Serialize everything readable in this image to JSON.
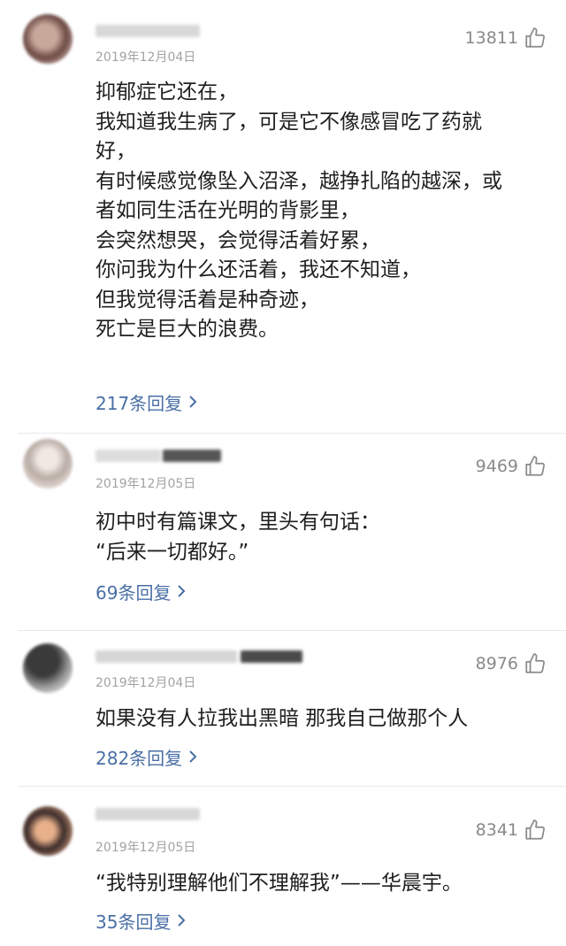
{
  "comments": [
    {
      "date": "2019年12月04日",
      "likes": "13811",
      "lines": [
        "抑郁症它还在，",
        "我知道我生病了，可是它不像感冒吃了药就",
        "好，",
        "有时候感觉像坠入沼泽，越挣扎陷的越深，或",
        "者如同生活在光明的背影里，",
        "会突然想哭，会觉得活着好累，",
        "你问我为什么还活着，我还不知道，",
        "但我觉得活着是种奇迹，",
        "死亡是巨大的浪费。"
      ],
      "replies": "217条回复"
    },
    {
      "date": "2019年12月05日",
      "likes": "9469",
      "lines": [
        "初中时有篇课文，里头有句话：",
        "“后来一切都好。”"
      ],
      "replies": "69条回复"
    },
    {
      "date": "2019年12月04日",
      "likes": "8976",
      "lines": [
        "如果没有人拉我出黑暗 那我自己做那个人"
      ],
      "replies": "282条回复"
    },
    {
      "date": "2019年12月05日",
      "likes": "8341",
      "lines": [
        "“我特别理解他们不理解我”——华晨宇。"
      ],
      "replies": "35条回复"
    }
  ],
  "icons": {
    "like": "thumbs-up-icon",
    "reply_arrow": "chevron-right-icon"
  },
  "colors": {
    "reply_link": "#4a6fa5",
    "date": "#a3a3a3",
    "likes": "#8a8a8a"
  }
}
